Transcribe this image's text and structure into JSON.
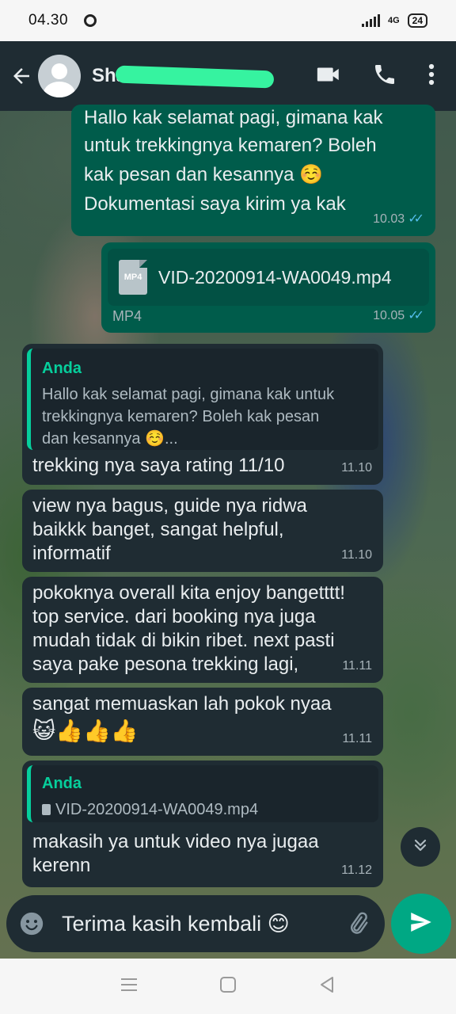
{
  "status_bar": {
    "time": "04.30",
    "network": "4G",
    "battery": "24"
  },
  "app_bar": {
    "contact_name": "Shan"
  },
  "messages": {
    "m1": {
      "text_1": "Hallo kak selamat pagi, gimana kak",
      "text_2": "untuk trekkingnya kemaren? Boleh",
      "text_3": "kak pesan dan kesannya ☺️",
      "text_4": "Dokumentasi saya kirim ya kak",
      "time": "10.03"
    },
    "m2": {
      "file_type": "MP4",
      "file_name": "VID-20200914-WA0049.mp4",
      "label": "MP4",
      "time": "10.05"
    },
    "m3": {
      "quote_author": "Anda",
      "quote_1": "Hallo kak selamat pagi, gimana kak untuk",
      "quote_2": "trekkingnya kemaren? Boleh kak pesan",
      "quote_3": "dan kesannya ☺️...",
      "text": "trekking nya saya rating 11/10",
      "time": "11.10"
    },
    "m4": {
      "text_1": "view nya bagus, guide nya ridwa",
      "text_2": "baikkk banget, sangat helpful,",
      "text_3": "informatif",
      "time": "11.10"
    },
    "m5": {
      "text_1": "pokoknya overall kita enjoy bangetttt!",
      "text_2": "top service. dari booking nya juga",
      "text_3": "mudah tidak di bikin ribet. next pasti",
      "text_4": "saya pake pesona trekking lagi,",
      "time": "11.11"
    },
    "m6": {
      "text_1": "sangat memuaskan lah pokok nyaa",
      "text_2": "😺👍👍👍",
      "time": "11.11"
    },
    "m7": {
      "quote_author": "Anda",
      "quote_file": "VID-20200914-WA0049.mp4",
      "text_1": "makasih ya untuk video nya jugaa",
      "text_2": "kerenn",
      "time": "11.12"
    }
  },
  "composer": {
    "text": "Terima kasih kembali 😊"
  },
  "colors": {
    "outgoing": "#005c4b",
    "incoming": "#1f2c33",
    "accent": "#00a884",
    "quote_accent": "#06cf9c",
    "read_ticks": "#53bdeb"
  },
  "icons": [
    "arrow-left-icon",
    "video-call-icon",
    "phone-icon",
    "more-vert-icon",
    "chevrons-down-icon",
    "emoji-icon",
    "paperclip-icon",
    "send-icon",
    "menu-icon",
    "home-icon",
    "back-icon"
  ]
}
